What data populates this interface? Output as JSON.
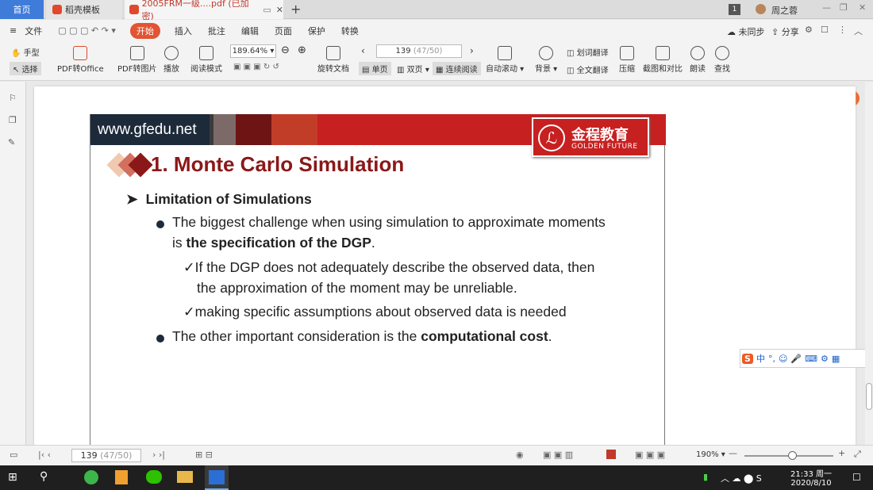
{
  "tabs": {
    "home": "首页",
    "docer": "稻壳模板",
    "pdf": "2005FRM一级....pdf (已加密)",
    "new_tab": "+"
  },
  "window": {
    "badge": "1",
    "user": "周之蓉"
  },
  "menu": {
    "file": "文件",
    "items": [
      "开始",
      "插入",
      "批注",
      "编辑",
      "页面",
      "保护",
      "转换"
    ],
    "unsync": "未同步",
    "share": "分享"
  },
  "ribbon": {
    "hand": "手型",
    "select": "选择",
    "pdf_to_office": "PDF转Office",
    "pdf_to_image": "PDF转图片",
    "play": "播放",
    "read_mode": "阅读模式",
    "zoom": "189.64%",
    "rotate": "旋转文档",
    "page_num": "139",
    "page_total": "(47/50)",
    "single": "单页",
    "double": "双页",
    "continuous": "连续阅读",
    "auto_scroll": "自动滚动",
    "background": "背景",
    "word_translate": "划词翻译",
    "full_translate": "全文翻译",
    "compress": "压缩",
    "screenshot": "截图和对比",
    "read_aloud": "朗读",
    "find": "查找"
  },
  "slide": {
    "url": "www.gfedu.net",
    "logo_cn": "金程教育",
    "logo_en": "GOLDEN FUTURE",
    "title": "1. Monte Carlo Simulation",
    "heading": "Limitation of Simulations",
    "b1_pre": "The biggest challenge when using simulation to approximate moments",
    "b1_line2_pre": "is ",
    "b1_bold": "the specification of the DGP",
    "b1_end": ".",
    "c1_l1": "If the DGP does not adequately describe the observed data, then",
    "c1_l2": "the approximation of the moment may be unreliable.",
    "c2": "making specific assumptions about observed data is needed",
    "b2_pre": "The other important consideration is the ",
    "b2_bold": "computational cost",
    "b2_end": "."
  },
  "status": {
    "page_num": "139",
    "page_total": "(47/50)",
    "zoom": "190%"
  },
  "ime": {
    "lang": "中"
  },
  "taskbar": {
    "time": "21:33 周一",
    "date": "2020/8/10"
  },
  "colors": {
    "accent_blue": "#3f7bd9",
    "slide_red": "#c72020",
    "title_red": "#8b1818",
    "start_orange": "#e25433"
  }
}
